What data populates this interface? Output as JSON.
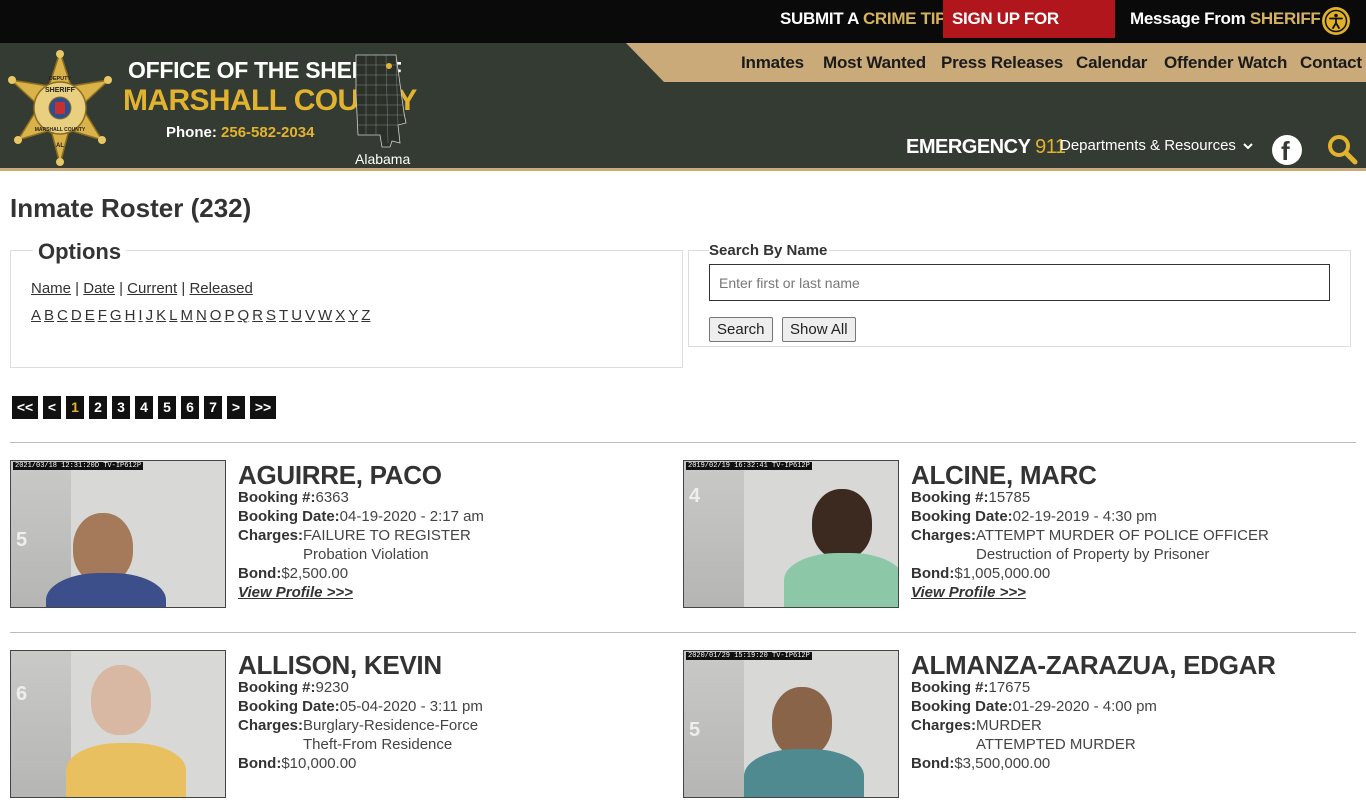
{
  "topbar": {
    "crime_tip_pre": "SUBMIT A",
    "crime_tip_accent": "CRIME TIP",
    "alerts": "SIGN UP FOR ALERTS",
    "message_pre": "Message From",
    "message_accent": "SHERIFF",
    "chevron": "›"
  },
  "header": {
    "title1": "OFFICE OF THE SHERIFF",
    "title2": "MARSHALL COUNTY",
    "phone_label": "Phone:",
    "phone_number": "256-582-2034",
    "state_label": "Alabama",
    "badge_lines": [
      "DEPUTY",
      "SHERIFF",
      "MARSHALL COUNTY",
      "AL"
    ],
    "emergency_label": "EMERGENCY",
    "emergency_number": "911",
    "departments": "Departments & Resources",
    "nav": [
      "Inmates",
      "Most Wanted",
      "Press Releases",
      "Calendar",
      "Offender Watch",
      "Contact"
    ],
    "facebook": "f"
  },
  "page": {
    "title": "Inmate Roster (232)",
    "options_legend": "Options",
    "sort_links": [
      "Name",
      "Date",
      "Current",
      "Released"
    ],
    "alphabet": [
      "A",
      "B",
      "C",
      "D",
      "E",
      "F",
      "G",
      "H",
      "I",
      "J",
      "K",
      "L",
      "M",
      "N",
      "O",
      "P",
      "Q",
      "R",
      "S",
      "T",
      "U",
      "V",
      "W",
      "X",
      "Y",
      "Z"
    ],
    "search_label": "Search By Name",
    "search_placeholder": "Enter first or last name",
    "search_button": "Search",
    "showall_button": "Show All"
  },
  "pager": [
    "<<",
    "<",
    "1",
    "2",
    "3",
    "4",
    "5",
    "6",
    "7",
    ">",
    ">>"
  ],
  "pager_active": "1",
  "labels": {
    "booking_no": "Booking #:",
    "booking_date": "Booking Date:",
    "charges": "Charges:",
    "bond": "Bond:",
    "view_profile": "View Profile >>>"
  },
  "inmates": [
    {
      "name": "AGUIRRE, PACO",
      "booking_no": "6363",
      "booking_date": "04-19-2020 - 2:17 am",
      "charges": [
        "FAILURE TO REGISTER",
        "Probation Violation"
      ],
      "bond": "$2,500.00",
      "photo_stamp": "2021/03/18 12:31:20D TV-IP612P",
      "ruler": "5"
    },
    {
      "name": "ALCINE, MARC",
      "booking_no": "15785",
      "booking_date": "02-19-2019 - 4:30 pm",
      "charges": [
        "ATTEMPT MURDER OF POLICE OFFICER",
        "Destruction of Property by Prisoner"
      ],
      "bond": "$1,005,000.00",
      "photo_stamp": "2019/02/19 16:32:41 TV-IP612P",
      "ruler": "4"
    },
    {
      "name": "ALLISON, KEVIN",
      "booking_no": "9230",
      "booking_date": "05-04-2020 - 3:11 pm",
      "charges": [
        "Burglary-Residence-Force",
        "Theft-From Residence"
      ],
      "bond": "$10,000.00",
      "photo_stamp": "",
      "ruler": "6"
    },
    {
      "name": "ALMANZA-ZARAZUA, EDGAR",
      "booking_no": "17675",
      "booking_date": "01-29-2020 - 4:00 pm",
      "charges": [
        "MURDER",
        "ATTEMPTED MURDER"
      ],
      "bond": "$3,500,000.00",
      "photo_stamp": "2020/01/29 15:19:20 TV-IP612P",
      "ruler": "5"
    }
  ],
  "colors": {
    "header_bg": "#343b32",
    "nav_band": "#c9aa78",
    "gold": "#e2b32e",
    "alert_red": "#b0161b"
  }
}
